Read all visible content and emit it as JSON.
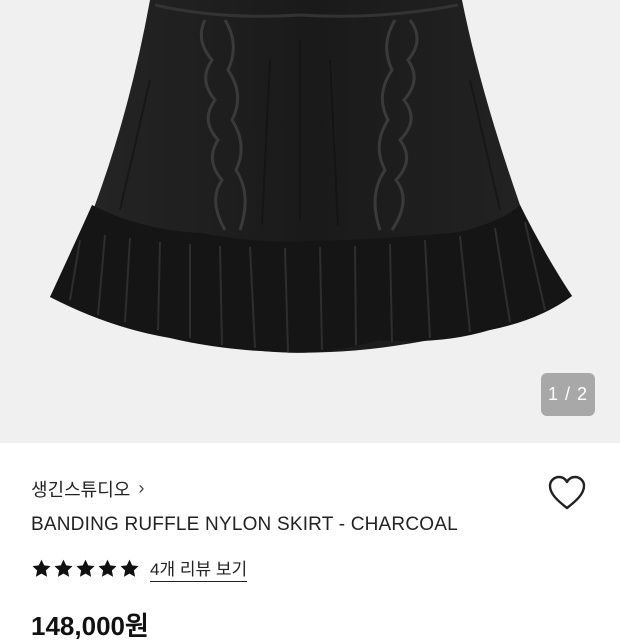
{
  "product": {
    "brand": "생긴스튜디오",
    "title": "BANDING RUFFLE NYLON SKIRT - CHARCOAL",
    "rating_stars": 5,
    "review_link": "4개 리뷰 보기",
    "price": "148,000원"
  },
  "gallery": {
    "page_indicator": "1 / 2",
    "current": 1,
    "total": 2
  },
  "icons": {
    "brand_chevron": "chevron-right-icon",
    "favorite": "heart-outline-icon",
    "star": "star-icon"
  },
  "colors": {
    "hero_background": "#f0f0f0",
    "skirt": "#1c1c1c",
    "text": "#222222"
  }
}
